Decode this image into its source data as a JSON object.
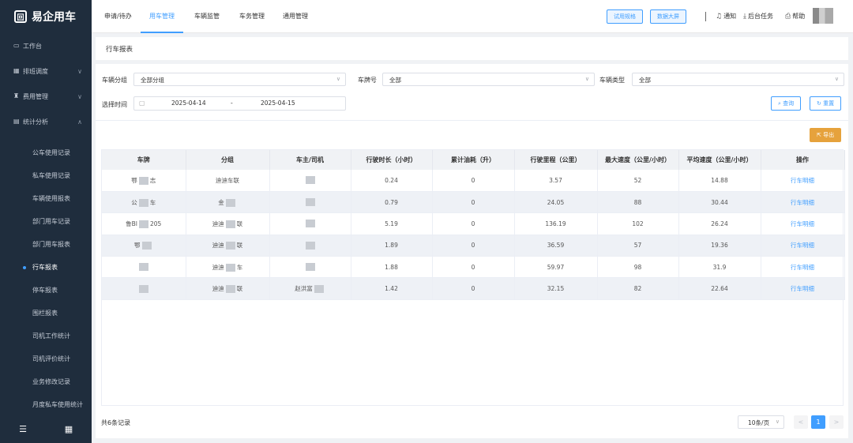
{
  "app": {
    "logo_glyph": "回",
    "name": "易企用车"
  },
  "sidebar": {
    "menu": [
      {
        "icon": "desktop-icon",
        "glyph": "▭",
        "label": "工作台",
        "chev": ""
      },
      {
        "icon": "calendar-icon",
        "glyph": "▦",
        "label": "排班调度",
        "chev": "∨"
      },
      {
        "icon": "money-bag-icon",
        "glyph": "♜",
        "label": "费用管理",
        "chev": "∨"
      },
      {
        "icon": "bar-chart-icon",
        "glyph": "▤",
        "label": "统计分析",
        "chev": "∧"
      }
    ],
    "sub": [
      "公车使用记录",
      "私车使用记录",
      "车辆使用报表",
      "部门用车记录",
      "部门用车报表",
      "行车报表",
      "停车报表",
      "围栏报表",
      "司机工作统计",
      "司机评价统计",
      "业务修改记录",
      "月度私车使用统计"
    ],
    "active_sub": "行车报表",
    "foot": {
      "collapse_glyph": "☰",
      "grid_glyph": "▦"
    }
  },
  "header": {
    "tabs": [
      "申请/待办",
      "用车管理",
      "车辆监管",
      "车务管理",
      "通用管理"
    ],
    "active_tab": "用车管理",
    "buttons": [
      "试用规格",
      "数据大屏"
    ],
    "links": [
      {
        "icon": "bell-icon",
        "glyph": "♫",
        "label": "通知"
      },
      {
        "icon": "download-icon",
        "glyph": "⤓",
        "label": "后台任务"
      },
      {
        "icon": "help-icon",
        "glyph": "⎙",
        "label": "帮助"
      }
    ]
  },
  "page_title": "行车报表",
  "filters": {
    "group_label": "车辆分组",
    "group_value": "全部分组",
    "plate_label": "车牌号",
    "plate_value": "全部",
    "type_label": "车辆类型",
    "type_value": "全部",
    "time_label": "选择时间",
    "date_start": "2025-04-14",
    "date_sep": "-",
    "date_end": "2025-04-15",
    "query_label": "查询",
    "query_glyph": "⌕",
    "reset_label": "重置",
    "reset_glyph": "↻",
    "arrow_glyph": "∨",
    "cal_glyph": "▢"
  },
  "export": {
    "glyph": "⇱",
    "label": "导出"
  },
  "table": {
    "headers": [
      "车牌",
      "分组",
      "车主/司机",
      "行驶时长（小时）",
      "累计油耗（升）",
      "行驶里程（公里）",
      "最大速度（公里/小时）",
      "平均速度（公里/小时）",
      "操作"
    ],
    "rows": [
      {
        "plate_a": "鄂",
        "plate_b": "志",
        "group": "迪迪车联",
        "driver_a": "",
        "driver_b": "",
        "hours": "0.24",
        "fuel": "0",
        "km": "3.57",
        "max": "52",
        "avg": "14.88",
        "op": "行车明细"
      },
      {
        "plate_a": "公",
        "plate_b": "车",
        "group_a": "金",
        "group_b": "",
        "driver_a": "",
        "driver_b": "",
        "hours": "0.79",
        "fuel": "0",
        "km": "24.05",
        "max": "88",
        "avg": "30.44",
        "op": "行车明细"
      },
      {
        "plate_a": "鲁BI",
        "plate_b": "205",
        "group_a": "迪迪",
        "group_b": "联",
        "driver_a": "",
        "driver_b": "",
        "hours": "5.19",
        "fuel": "0",
        "km": "136.19",
        "max": "102",
        "avg": "26.24",
        "op": "行车明细"
      },
      {
        "plate_a": "鄂",
        "plate_b": "",
        "group_a": "迪迪",
        "group_b": "联",
        "driver_a": "",
        "driver_b": "",
        "hours": "1.89",
        "fuel": "0",
        "km": "36.59",
        "max": "57",
        "avg": "19.36",
        "op": "行车明细"
      },
      {
        "plate_a": "",
        "plate_b": "",
        "group_a": "迪迪",
        "group_b": "车",
        "driver_a": "",
        "driver_b": "",
        "hours": "1.88",
        "fuel": "0",
        "km": "59.97",
        "max": "98",
        "avg": "31.9",
        "op": "行车明细"
      },
      {
        "plate_a": "",
        "plate_b": "",
        "group_a": "迪迪",
        "group_b": "联",
        "driver_a": "赵洪富",
        "driver_b": "",
        "hours": "1.42",
        "fuel": "0",
        "km": "32.15",
        "max": "82",
        "avg": "22.64",
        "op": "行车明细"
      }
    ]
  },
  "footer": {
    "total_prefix": "共",
    "total_count": "6",
    "total_suffix": "条记录",
    "page_size": "10条/页",
    "prev": "<",
    "page": "1",
    "next": ">"
  }
}
